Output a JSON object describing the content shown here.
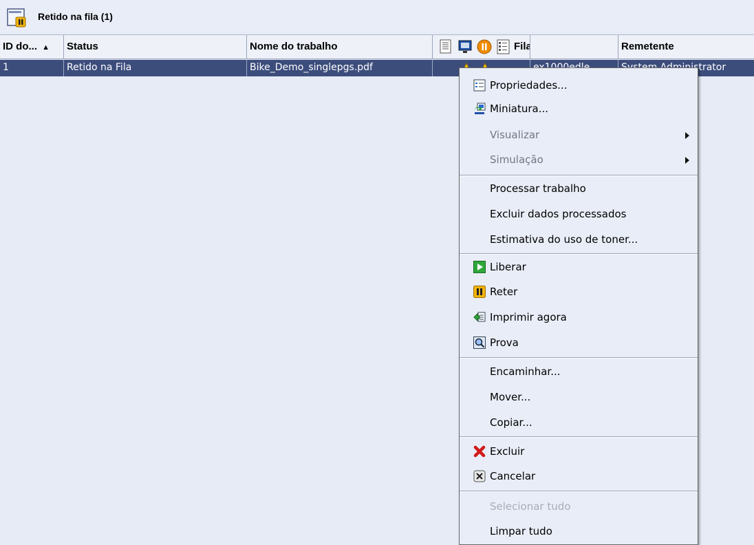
{
  "header": {
    "title": "Retido na fila (1)"
  },
  "table": {
    "columns": {
      "id": "ID do...",
      "status": "Status",
      "job_name": "Nome do trabalho",
      "queue": "Fila",
      "sender": "Remetente"
    },
    "sort_indicator": "▲",
    "rows": [
      {
        "id": "1",
        "status": "Retido na Fila",
        "job_name": "Bike_Demo_singlepgs.pdf",
        "queue": "ex1000edle",
        "sender": "System Administrator"
      }
    ]
  },
  "context_menu": {
    "items": [
      {
        "label": "Propriedades...",
        "icon": "properties-icon"
      },
      {
        "label": "Miniatura...",
        "icon": "thumbnail-icon"
      },
      {
        "label": "Visualizar",
        "submenu": true
      },
      {
        "label": "Simulação",
        "submenu": true
      },
      {
        "label": "Processar trabalho"
      },
      {
        "label": "Excluir dados processados"
      },
      {
        "label": "Estimativa do uso de toner..."
      },
      {
        "label": "Liberar",
        "icon": "play-icon"
      },
      {
        "label": "Reter",
        "icon": "pause-icon"
      },
      {
        "label": "Imprimir agora",
        "icon": "print-now-icon"
      },
      {
        "label": "Prova",
        "icon": "proof-icon"
      },
      {
        "label": "Encaminhar..."
      },
      {
        "label": "Mover..."
      },
      {
        "label": "Copiar..."
      },
      {
        "label": "Excluir",
        "icon": "delete-x-icon"
      },
      {
        "label": "Cancelar",
        "icon": "cancel-icon"
      },
      {
        "label": "Selecionar tudo",
        "disabled": true
      },
      {
        "label": "Limpar tudo"
      }
    ]
  },
  "colors": {
    "selected_row": "#3c4d7c",
    "background": "#e6ebf6",
    "menu_background": "#e9edf7"
  }
}
